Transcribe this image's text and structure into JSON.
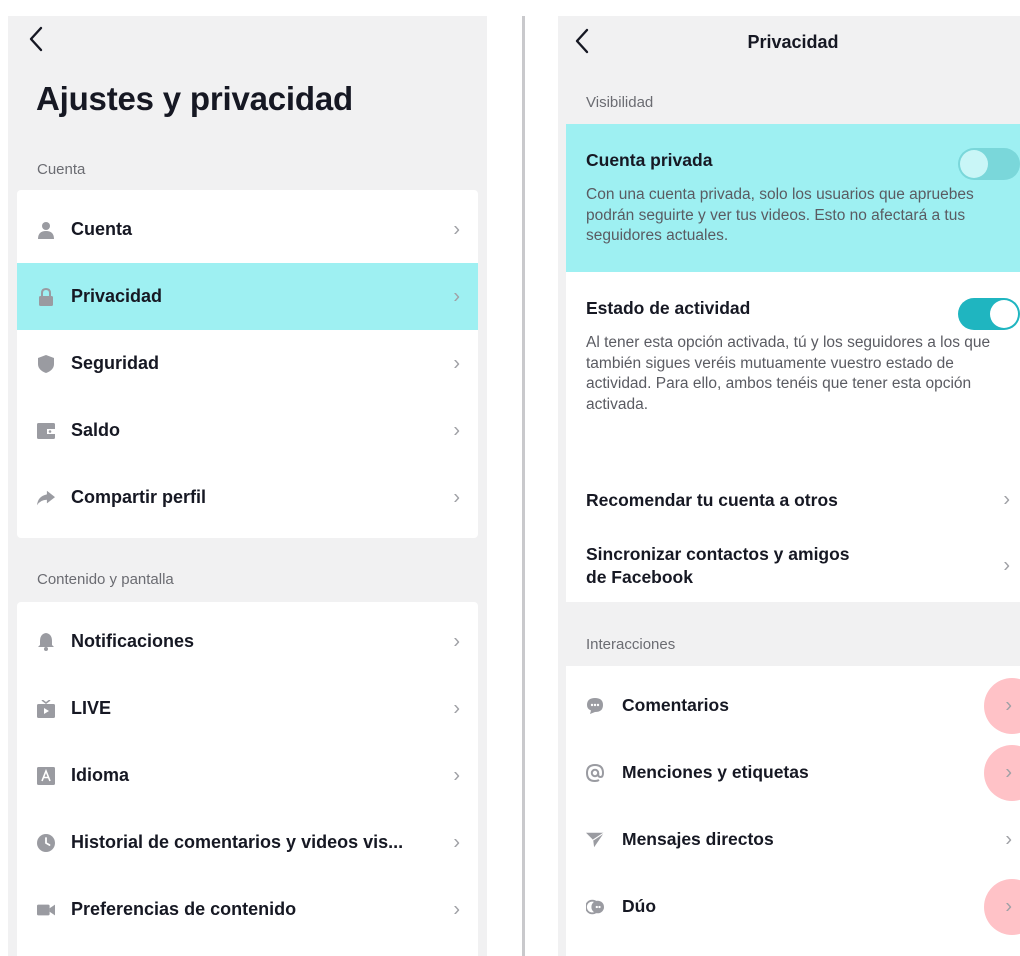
{
  "left": {
    "back_icon": "chevron-left",
    "title": "Ajustes y privacidad",
    "section_account": "Cuenta",
    "account_items": [
      {
        "label": "Cuenta",
        "icon": "person-icon"
      },
      {
        "label": "Privacidad",
        "icon": "lock-icon",
        "highlighted": true
      },
      {
        "label": "Seguridad",
        "icon": "shield-icon"
      },
      {
        "label": "Saldo",
        "icon": "wallet-icon"
      },
      {
        "label": "Compartir perfil",
        "icon": "share-icon"
      }
    ],
    "section_content": "Contenido y pantalla",
    "content_items": [
      {
        "label": "Notificaciones",
        "icon": "bell-icon"
      },
      {
        "label": "LIVE",
        "icon": "live-tv-icon"
      },
      {
        "label": "Idioma",
        "icon": "language-icon"
      },
      {
        "label": "Historial de comentarios y videos vis...",
        "icon": "clock-icon"
      },
      {
        "label": "Preferencias de contenido",
        "icon": "video-camera-icon"
      }
    ]
  },
  "right": {
    "title": "Privacidad",
    "section_visibility": "Visibilidad",
    "private_account": {
      "title": "Cuenta privada",
      "description": "Con una cuenta privada, solo los usuarios que apruebes podrán seguirte y ver tus videos. Esto no afectará a tus seguidores actuales.",
      "enabled": false
    },
    "activity_status": {
      "title": "Estado de actividad",
      "description": "Al tener esta opción activada, tú y los seguidores a los que también sigues veréis mutuamente vuestro estado de actividad. Para ello, ambos tenéis que tener esta opción activada.",
      "enabled": true
    },
    "recommend_label": "Recomendar tu cuenta a otros",
    "sync_label_line1": "Sincronizar contactos y amigos",
    "sync_label_line2": "de Facebook",
    "section_interactions": "Interacciones",
    "interaction_items": [
      {
        "label": "Comentarios",
        "icon": "comment-icon",
        "marked": true
      },
      {
        "label": "Menciones y etiquetas",
        "icon": "at-icon",
        "marked": true
      },
      {
        "label": "Mensajes directos",
        "icon": "send-icon",
        "marked": false
      },
      {
        "label": "Dúo",
        "icon": "duet-icon",
        "marked": true
      }
    ]
  },
  "colors": {
    "highlight": "#9ef0f2",
    "marker": "#ffc2c7",
    "toggle_on": "#1fb5c0"
  }
}
